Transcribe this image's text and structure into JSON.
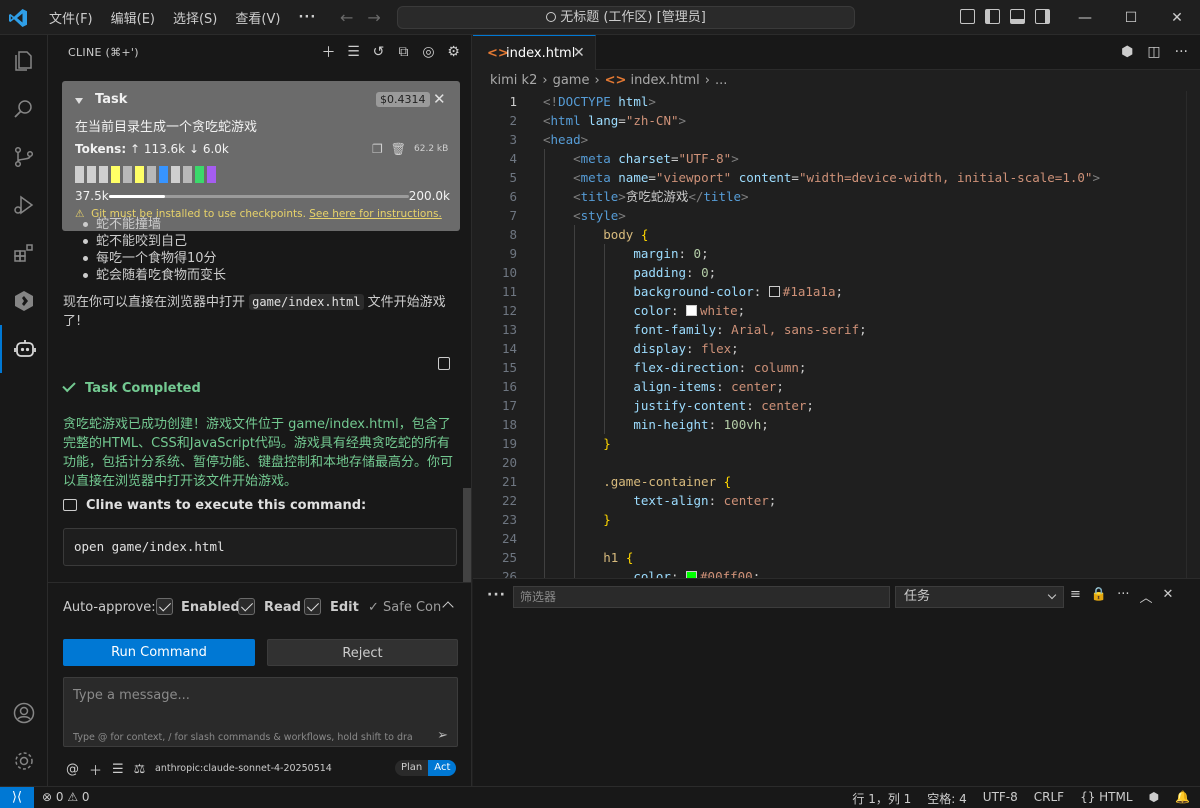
{
  "titlebar": {
    "menu": [
      "文件(F)",
      "编辑(E)",
      "选择(S)",
      "查看(V)"
    ],
    "more": "···",
    "command_center": "无标题 (工作区) [管理员]"
  },
  "sidebar": {
    "title": "CLINE (⌘+')",
    "task": {
      "label": "Task",
      "cost": "$0.4314",
      "description": "在当前目录生成一个贪吃蛇游戏",
      "tokens_label": "Tokens:",
      "tokens_in": "↑ 113.6k",
      "tokens_out": "↓ 6.0k",
      "size": "62.2 kB",
      "context_used": "37.5k",
      "context_max": "200.0k",
      "context_fraction": 0.1875,
      "warning": "Git must be installed to use checkpoints.",
      "warning_link": "See here for instructions."
    },
    "rules": [
      "蛇不能撞墙",
      "蛇不能咬到自己",
      "每吃一个食物得10分",
      "蛇会随着吃食物而变长"
    ],
    "para_before": "现在你可以直接在浏览器中打开",
    "para_code": "game/index.html",
    "para_after": "文件开始游戏了!",
    "task_completed": "Task Completed",
    "completed_text": "贪吃蛇游戏已成功创建！游戏文件位于 game/index.html，包含了完整的HTML、CSS和JavaScript代码。游戏具有经典贪吃蛇的所有功能，包括计分系统、暂停功能、键盘控制和本地存储最高分。你可以直接在浏览器中打开该文件开始游戏。",
    "command_header": "Cline wants to execute this command:",
    "command": "open game/index.html",
    "auto_approve": {
      "label": "Auto-approve:",
      "enabled": "Enabled",
      "read": "Read",
      "edit": "Edit",
      "safe": "✓ Safe Con"
    },
    "run_button": "Run Command",
    "reject_button": "Reject",
    "message_placeholder": "Type a message...",
    "message_hint": "Type @ for context, / for slash commands & workflows, hold shift to drag i...",
    "model": "anthropic:claude-sonnet-4-20250514",
    "mode_plan": "Plan",
    "mode_act": "Act"
  },
  "editor": {
    "tab_name": "index.html",
    "breadcrumb": [
      "kimi k2",
      "game",
      "index.html",
      "..."
    ]
  },
  "panel": {
    "filter_placeholder": "筛选器",
    "task_select": "任务"
  },
  "statusbar": {
    "problems": "⊗ 0 ⚠ 0",
    "position": "行 1，列 1",
    "spaces": "空格: 4",
    "encoding": "UTF-8",
    "eol": "CRLF",
    "language": "{} HTML"
  },
  "colors": {
    "accent": "#0078d4",
    "success": "#73c991",
    "warning": "#e8d36a",
    "swatch_bg": "#1a1a1a",
    "swatch_green": "#00ff00"
  }
}
